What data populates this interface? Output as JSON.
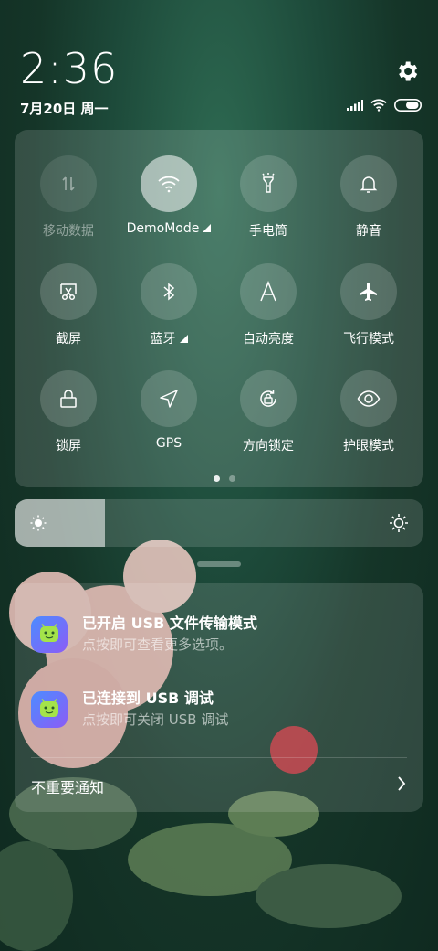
{
  "status": {
    "time": "2:36",
    "date": "7月20日 周一",
    "icons": [
      "signal-icon",
      "wifi-icon",
      "battery-icon"
    ]
  },
  "quick_settings": {
    "tiles": [
      {
        "name": "mobile-data",
        "label": "移动数据",
        "icon": "mobile-data-icon",
        "state": "disabled"
      },
      {
        "name": "wifi",
        "label": "DemoMode",
        "icon": "wifi-icon",
        "state": "active",
        "has_menu": true
      },
      {
        "name": "flashlight",
        "label": "手电筒",
        "icon": "flashlight-icon",
        "state": "off"
      },
      {
        "name": "silent",
        "label": "静音",
        "icon": "bell-icon",
        "state": "off"
      },
      {
        "name": "screenshot",
        "label": "截屏",
        "icon": "scissors-icon",
        "state": "off"
      },
      {
        "name": "bluetooth",
        "label": "蓝牙",
        "icon": "bluetooth-icon",
        "state": "off",
        "has_menu": true
      },
      {
        "name": "auto-brightness",
        "label": "自动亮度",
        "icon": "letter-a-icon",
        "state": "off"
      },
      {
        "name": "airplane",
        "label": "飞行模式",
        "icon": "airplane-icon",
        "state": "off"
      },
      {
        "name": "lock-screen",
        "label": "锁屏",
        "icon": "lock-icon",
        "state": "off"
      },
      {
        "name": "gps",
        "label": "GPS",
        "icon": "location-arrow-icon",
        "state": "off"
      },
      {
        "name": "rotation-lock",
        "label": "方向锁定",
        "icon": "rotation-lock-icon",
        "state": "off"
      },
      {
        "name": "eye-care",
        "label": "护眼模式",
        "icon": "eye-icon",
        "state": "off"
      }
    ],
    "pages": 2,
    "current_page": 1
  },
  "brightness": {
    "level": 0.22
  },
  "notifications": [
    {
      "title": "已开启 USB 文件传输模式",
      "body": "点按即可查看更多选项。",
      "icon": "android-robot-icon"
    },
    {
      "title": "已连接到 USB 调试",
      "body": "点按即可关闭 USB 调试",
      "icon": "android-robot-icon"
    }
  ],
  "unimportant": {
    "label": "不重要通知"
  },
  "colors": {
    "app_icon_start": "#4c8cff",
    "app_icon_end": "#8b5cf6",
    "robot": "#a4e34a"
  }
}
